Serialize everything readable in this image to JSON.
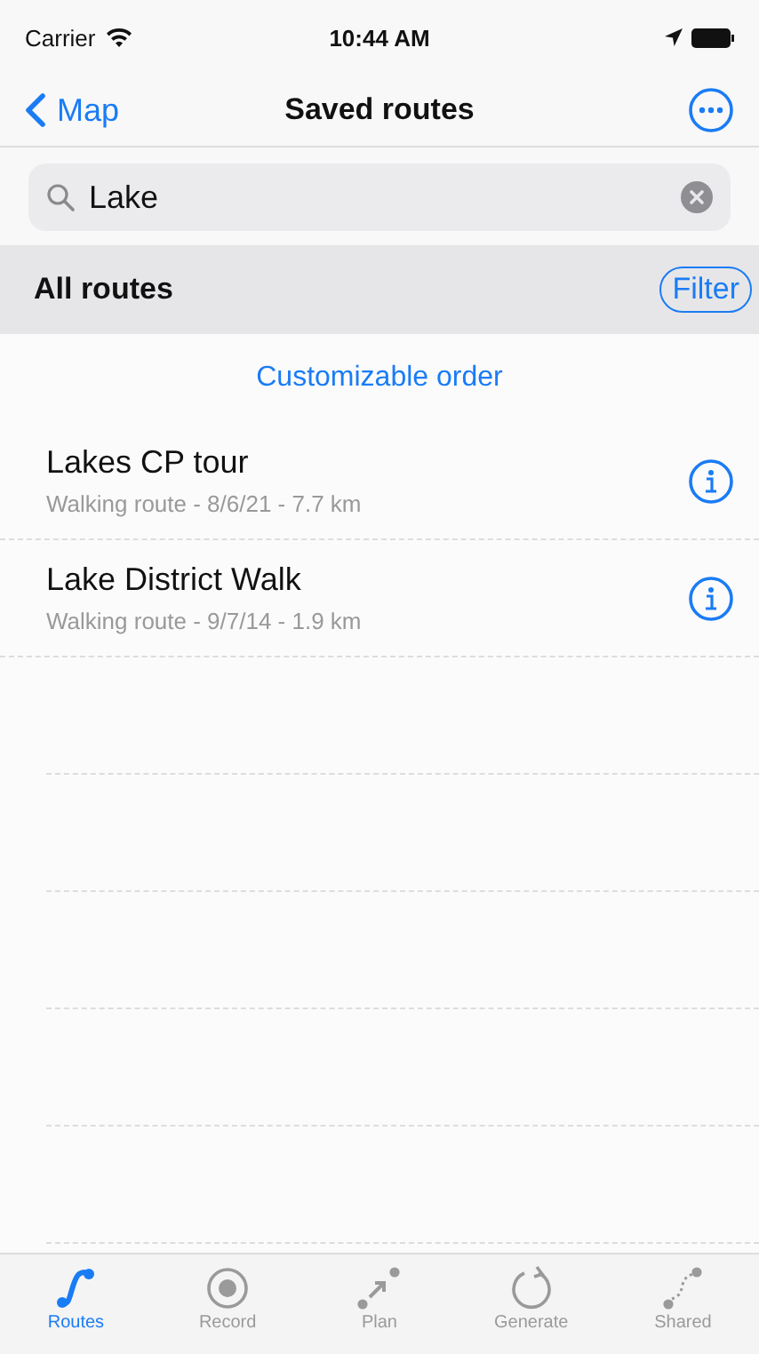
{
  "status_bar": {
    "carrier": "Carrier",
    "time": "10:44 AM"
  },
  "nav": {
    "back": "Map",
    "title": "Saved routes"
  },
  "search": {
    "value": "Lake"
  },
  "section": {
    "title": "All routes",
    "filter": "Filter"
  },
  "order_link": "Customizable order",
  "routes": [
    {
      "name": "Lakes CP tour",
      "details": "Walking route - 8/6/21 - 7.7 km"
    },
    {
      "name": "Lake District Walk",
      "details": "Walking route - 9/7/14 - 1.9 km"
    }
  ],
  "tabs": [
    {
      "label": "Routes",
      "kind": "routes",
      "selected": true
    },
    {
      "label": "Record",
      "kind": "record",
      "selected": false
    },
    {
      "label": "Plan",
      "kind": "plan",
      "selected": false
    },
    {
      "label": "Generate",
      "kind": "generate",
      "selected": false
    },
    {
      "label": "Shared",
      "kind": "shared",
      "selected": false
    }
  ]
}
